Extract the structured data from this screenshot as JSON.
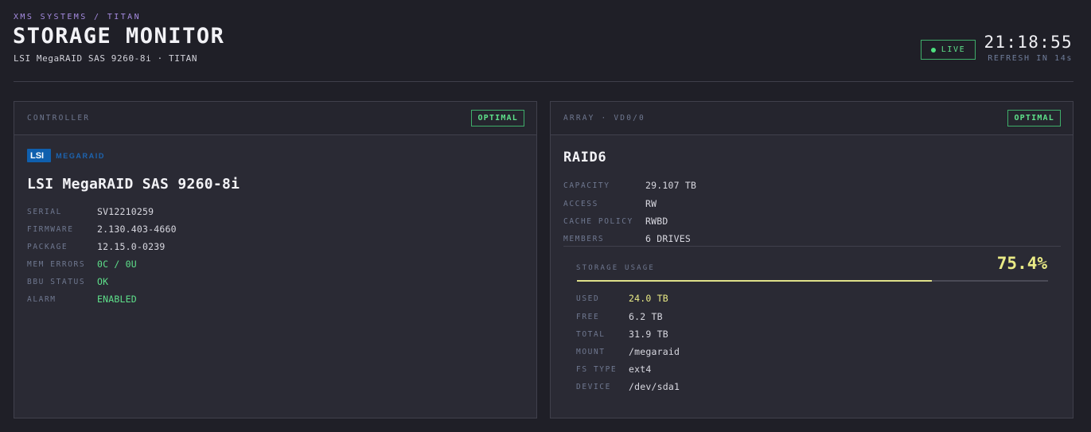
{
  "header": {
    "breadcrumb": "XMS SYSTEMS / TITAN",
    "title": "STORAGE MONITOR",
    "subtitle": "LSI MegaRAID SAS 9260-8i · TITAN",
    "live_label": "LIVE",
    "clock": "21:18:55",
    "refresh_prefix": "REFRESH IN",
    "refresh_value": "14s"
  },
  "controller": {
    "panel_label": "CONTROLLER",
    "status": "OPTIMAL",
    "logo_box": "LSI",
    "logo_word": "MEGARAID",
    "model": "LSI MegaRAID SAS 9260-8i",
    "fields": [
      {
        "key": "SERIAL",
        "value": "SV12210259",
        "color": "#d8d8e0"
      },
      {
        "key": "FIRMWARE",
        "value": "2.130.403-4660",
        "color": "#d8d8e0"
      },
      {
        "key": "PACKAGE",
        "value": "12.15.0-0239",
        "color": "#d8d8e0"
      },
      {
        "key": "MEM ERRORS",
        "value": "0C / 0U",
        "color": "#5ee08a"
      },
      {
        "key": "BBU STATUS",
        "value": "OK",
        "color": "#5ee08a"
      },
      {
        "key": "ALARM",
        "value": "ENABLED",
        "color": "#5ee08a"
      }
    ]
  },
  "array": {
    "panel_label": "ARRAY · VD0/0",
    "status": "OPTIMAL",
    "raid_level": "RAID6",
    "fields": [
      {
        "key": "CAPACITY",
        "value": "29.107 TB"
      },
      {
        "key": "ACCESS",
        "value": "RW"
      },
      {
        "key": "CACHE POLICY",
        "value": "RWBD"
      },
      {
        "key": "MEMBERS",
        "value": "6 DRIVES"
      }
    ],
    "usage": {
      "label": "STORAGE USAGE",
      "percent_text": "75.4%",
      "fraction": 0.754,
      "fields": [
        {
          "key": "USED",
          "value": "24.0 TB"
        },
        {
          "key": "FREE",
          "value": "6.2 TB"
        },
        {
          "key": "TOTAL",
          "value": "31.9 TB"
        },
        {
          "key": "MOUNT",
          "value": "/megaraid"
        },
        {
          "key": "FS TYPE",
          "value": "ext4"
        },
        {
          "key": "DEVICE",
          "value": "/dev/sda1"
        }
      ]
    }
  },
  "colors": {
    "accent_green": "#5ee08a",
    "accent_yellow": "#eaeb86",
    "accent_purple": "#a58be0",
    "background": "#1f1f27"
  }
}
